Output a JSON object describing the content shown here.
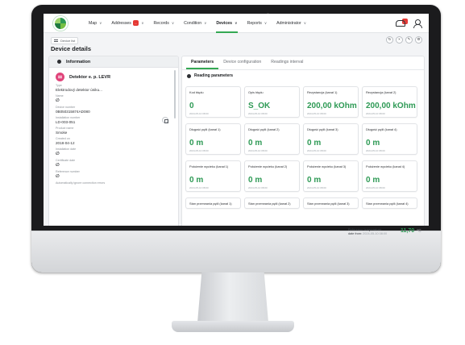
{
  "nav": {
    "items": [
      {
        "label": "Map",
        "has_chevron": true,
        "badge": ""
      },
      {
        "label": "Addresses",
        "has_chevron": true,
        "badge": "..."
      },
      {
        "label": "Records",
        "has_chevron": true,
        "badge": ""
      },
      {
        "label": "Condition",
        "has_chevron": true,
        "badge": ""
      },
      {
        "label": "Devices",
        "has_chevron": true,
        "badge": "",
        "active": true
      },
      {
        "label": "Reports",
        "has_chevron": true,
        "badge": ""
      },
      {
        "label": "Administrator",
        "has_chevron": true,
        "badge": ""
      }
    ],
    "notification_badge": "..."
  },
  "breadcrumb": {
    "label": "Device list"
  },
  "page": {
    "title": "Device details"
  },
  "info": {
    "header": "Information",
    "device_name": "Detektor e. p. LEVR",
    "fields": [
      {
        "label": "Type",
        "value": "Elektrodový detektor úniku..."
      },
      {
        "label": "Name",
        "value": "∅",
        "symbol": true
      },
      {
        "label": "Device number",
        "value": "0B050315874AD080"
      },
      {
        "label": "Installation number",
        "value": "LD-003-051"
      },
      {
        "label": "Product name",
        "value": "Smoke"
      },
      {
        "label": "Created on",
        "value": "2018-04-12"
      },
      {
        "label": "Installation date",
        "value": "∅",
        "symbol": true
      },
      {
        "label": "Certificate date",
        "value": "∅",
        "symbol": true
      },
      {
        "label": "Reference number",
        "value": "∅",
        "symbol": true
      },
      {
        "label": "Automatically ignore connection errors",
        "value": ""
      }
    ]
  },
  "tabs": [
    {
      "label": "Parameters",
      "active": true
    },
    {
      "label": "Device configuration",
      "active": false
    },
    {
      "label": "Readings interval",
      "active": false
    }
  ],
  "section": {
    "title": "Reading parameters"
  },
  "tiles": [
    {
      "name": "Kod błędu",
      "value": "0",
      "date": "2024-05-10 08:00"
    },
    {
      "name": "Opis błędu",
      "value": "S_OK",
      "date": "2024-05-10 08:00"
    },
    {
      "name": "Rezystancja (kanał 1)",
      "value": "200,00 kOhm",
      "date": "2024-05-10 08:00"
    },
    {
      "name": "Rezystancja (kanał 2)",
      "value": "200,00 kOhm",
      "date": "2024-05-10 08:00"
    },
    {
      "name": "Długość pętli (kanał 1)",
      "value": "0 m",
      "date": "2024-05-10 08:00"
    },
    {
      "name": "Długość pętli (kanał 2)",
      "value": "0 m",
      "date": "2024-05-10 08:00"
    },
    {
      "name": "Długość pętli (kanał 3)",
      "value": "0 m",
      "date": "2024-05-10 08:00"
    },
    {
      "name": "Długość pętli (kanał 4)",
      "value": "0 m",
      "date": "2024-05-10 08:00"
    },
    {
      "name": "Położenie wycieku (kanał 1)",
      "value": "0 m",
      "date": "2024-05-10 08:00"
    },
    {
      "name": "Położenie wycieku (kanał 2)",
      "value": "0 m",
      "date": "2024-05-10 08:00"
    },
    {
      "name": "Położenie wycieku (kanał 3)",
      "value": "0 m",
      "date": "2024-05-10 08:00"
    },
    {
      "name": "Położenie wycieku (kanał 4)",
      "value": "0 m",
      "date": "2024-05-10 08:00"
    },
    {
      "name": "Stan przerwania pętli (kanał 1)",
      "value": "",
      "date": ""
    },
    {
      "name": "Stan przerwania pętli (kanał 2)",
      "value": "",
      "date": ""
    },
    {
      "name": "Stan przerwania pętli (kanał 3)",
      "value": "",
      "date": ""
    },
    {
      "name": "Stan przerwania pętli (kanał 4)",
      "value": "",
      "date": ""
    }
  ],
  "reference": {
    "label": "Reference temperature",
    "date_prefix": "date from:",
    "date": "2024-05-10 08:00",
    "temperature": "11,70",
    "unit": "°C"
  },
  "colors": {
    "accent": "#34a853",
    "value_green": "#2e9a55",
    "badge_red": "#e53935",
    "device_icon": "#e0457b"
  }
}
